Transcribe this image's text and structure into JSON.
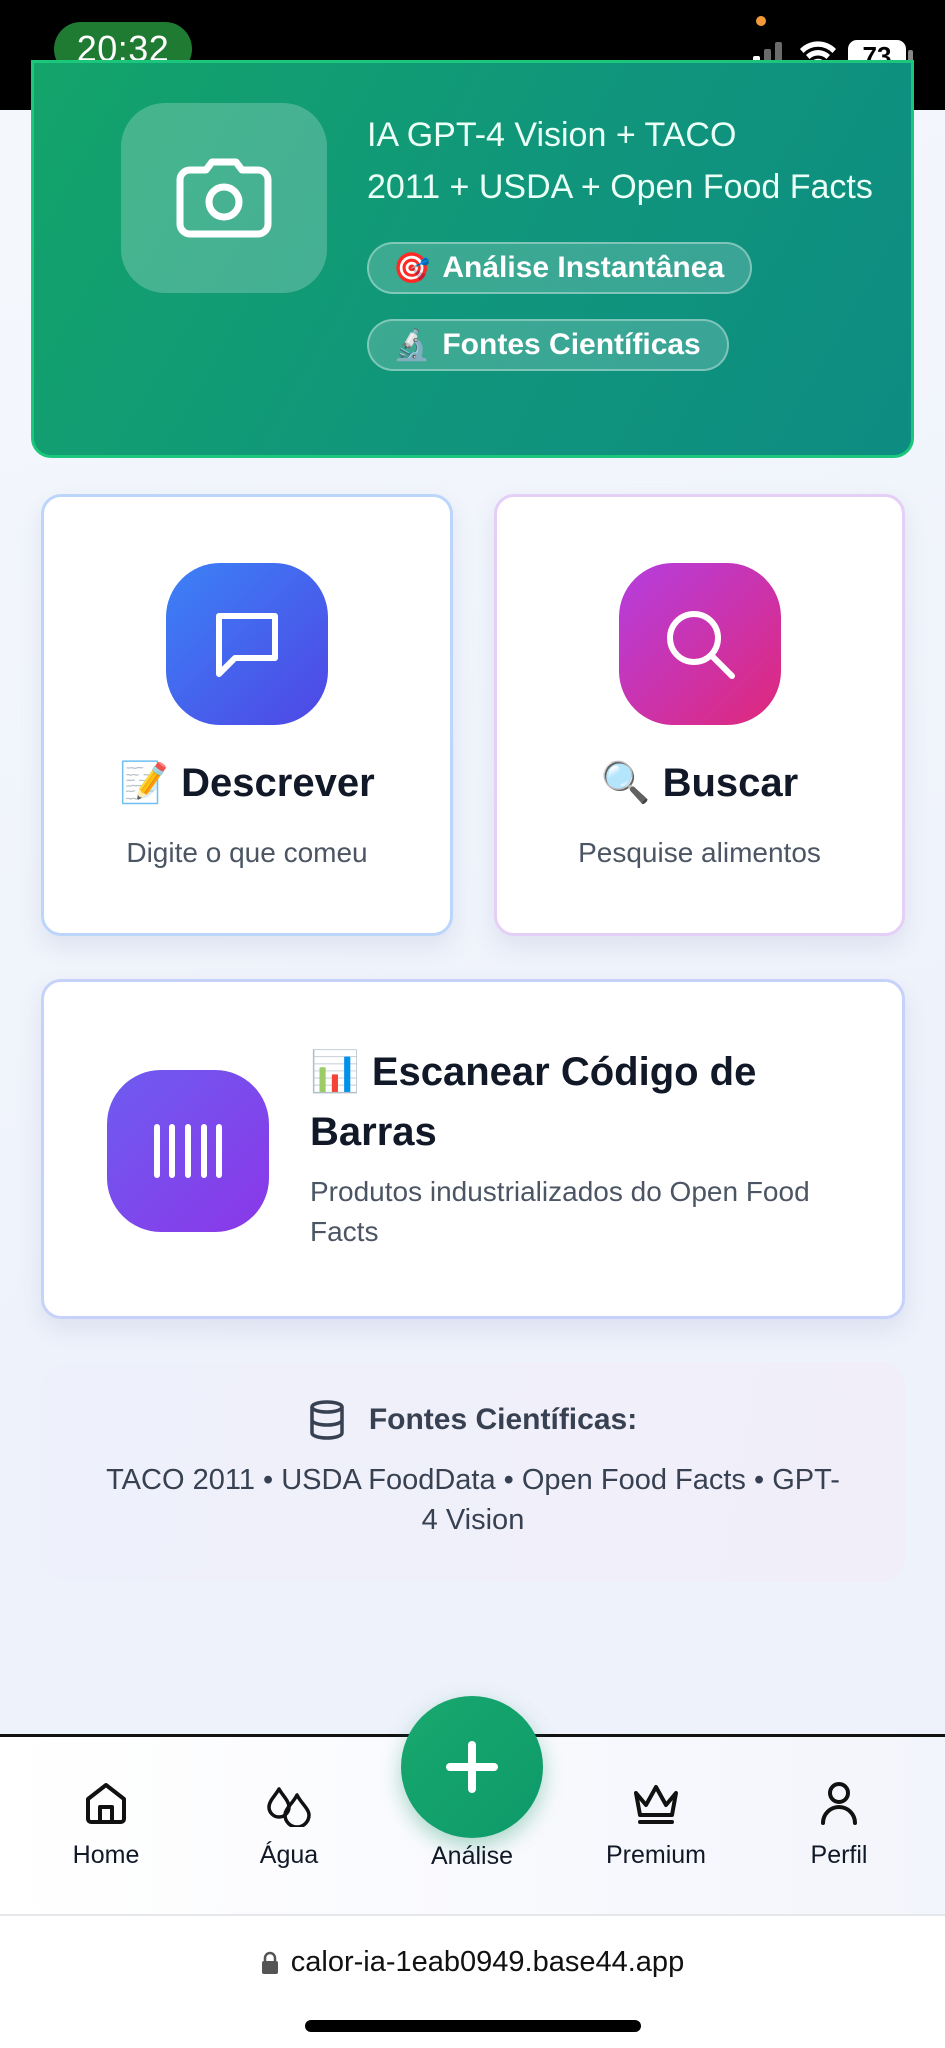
{
  "status_bar": {
    "time": "20:32",
    "battery": "73"
  },
  "hero": {
    "subtitle_line1": "IA GPT-4 Vision + TACO",
    "subtitle_line2": "2011 + USDA + Open Food Facts",
    "chips": [
      {
        "emoji": "🎯",
        "label": "Análise Instantânea"
      },
      {
        "emoji": "🔬",
        "label": "Fontes Científicas"
      }
    ]
  },
  "options": {
    "describe": {
      "emoji": "📝",
      "title": "Descrever",
      "desc": "Digite o que comeu"
    },
    "search": {
      "emoji": "🔍",
      "title": "Buscar",
      "desc": "Pesquise alimentos"
    },
    "barcode": {
      "emoji": "📊",
      "title": "Escanear Código de Barras",
      "desc": "Produtos industrializados do Open Food Facts"
    }
  },
  "sources": {
    "title": "Fontes Científicas:",
    "list": "TACO 2011 • USDA FoodData • Open Food Facts • GPT-4 Vision"
  },
  "nav": {
    "items": [
      {
        "label": "Home",
        "icon": "home-icon"
      },
      {
        "label": "Água",
        "icon": "water-drops-icon"
      },
      {
        "label": "Análise",
        "icon": "plus-icon"
      },
      {
        "label": "Premium",
        "icon": "crown-icon"
      },
      {
        "label": "Perfil",
        "icon": "user-icon"
      }
    ]
  },
  "browser": {
    "url": "calor-ia-1eab0949.base44.app"
  },
  "colors": {
    "brand_green": "#10957c",
    "blue": "#4f46e5",
    "pink": "#e0287a",
    "purple": "#8b37e8"
  }
}
